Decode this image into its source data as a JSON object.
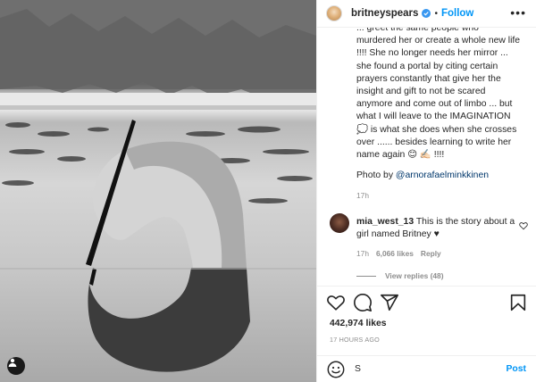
{
  "header": {
    "username": "britneyspears",
    "separator": "•",
    "follow_label": "Follow",
    "more_label": "•••"
  },
  "caption": {
    "text": "... greet the same people who murdered her or create a whole new life !!!! She no longer needs her mirror ... she found a portal by citing certain prayers constantly that give her the insight and gift to not be scared anymore and come out of limbo ... but what I will leave to the IMAGINATION 💭 is what she does when she crosses over ...... besides learning to write her name again 😊 ✍🏻 !!!!",
    "credit_prefix": "Photo by ",
    "credit_handle": "@arnorafaelminkkinen",
    "time": "17h"
  },
  "comment": {
    "username": "mia_west_13",
    "text": " This is the story about a girl named Britney ♥",
    "time": "17h",
    "likes": "6,066 likes",
    "reply_label": "Reply",
    "view_replies": "View replies (48)"
  },
  "post": {
    "likes": "442,974 likes",
    "time": "17 HOURS AGO"
  },
  "composer": {
    "value": "S",
    "post_label": "Post"
  },
  "icons": {
    "verified": "verified-badge-icon",
    "like": "heart-icon",
    "comment": "comment-icon",
    "share": "paper-plane-icon",
    "save": "bookmark-icon",
    "emoji": "smiley-icon",
    "more": "ellipsis-icon"
  },
  "colors": {
    "accent": "#0095f6",
    "text": "#262626",
    "muted": "#8e8e8e",
    "link": "#00376b",
    "border": "#efefef"
  }
}
